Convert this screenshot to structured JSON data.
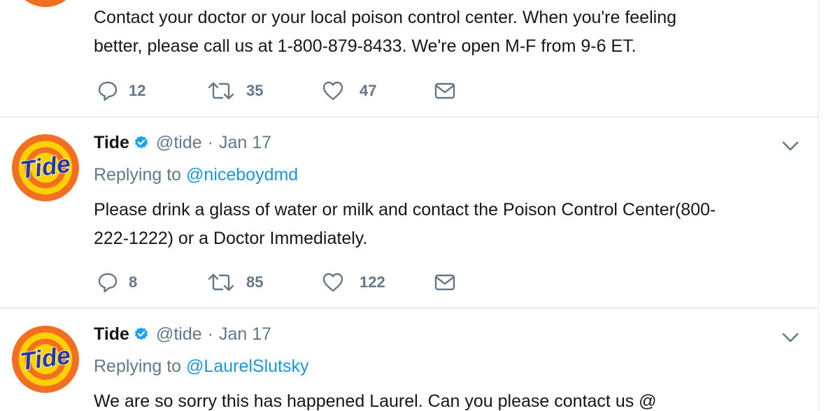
{
  "tweets": [
    {
      "text_line1": "Contact your doctor or your local poison control center. When you're feeling",
      "text_line2": "better, please call us at 1-800-879-8433. We're open M-F from 9-6 ET.",
      "replies": "12",
      "retweets": "35",
      "likes": "47"
    },
    {
      "name": "Tide",
      "handle": "@tide",
      "separator": "·",
      "date": "Jan 17",
      "replying_prefix": "Replying to",
      "replying_to": "@niceboydmd",
      "text_line1": "Please drink a glass of water or milk and contact the Poison Control Center(800-",
      "text_line2": "222-1222) or a Doctor Immediately.",
      "replies": "8",
      "retweets": "85",
      "likes": "122"
    },
    {
      "name": "Tide",
      "handle": "@tide",
      "separator": "·",
      "date": "Jan 17",
      "replying_prefix": "Replying to",
      "replying_to": "@LaurelSlutsky",
      "text_line1": "We are so sorry this has happened Laurel. Can you please contact us @"
    }
  ],
  "logo_text": "Tide",
  "colors": {
    "logo_orange": "#f26f21",
    "logo_yellow": "#ffd100",
    "logo_blue": "#2a3996",
    "verified_blue": "#1da1f2",
    "link_blue": "#1b95e0",
    "muted_gray": "#657786"
  },
  "icons": {
    "reply": "reply-icon",
    "retweet": "retweet-icon",
    "like": "heart-icon",
    "dm": "envelope-icon",
    "caret": "chevron-down-icon",
    "verified": "verified-badge-icon"
  }
}
